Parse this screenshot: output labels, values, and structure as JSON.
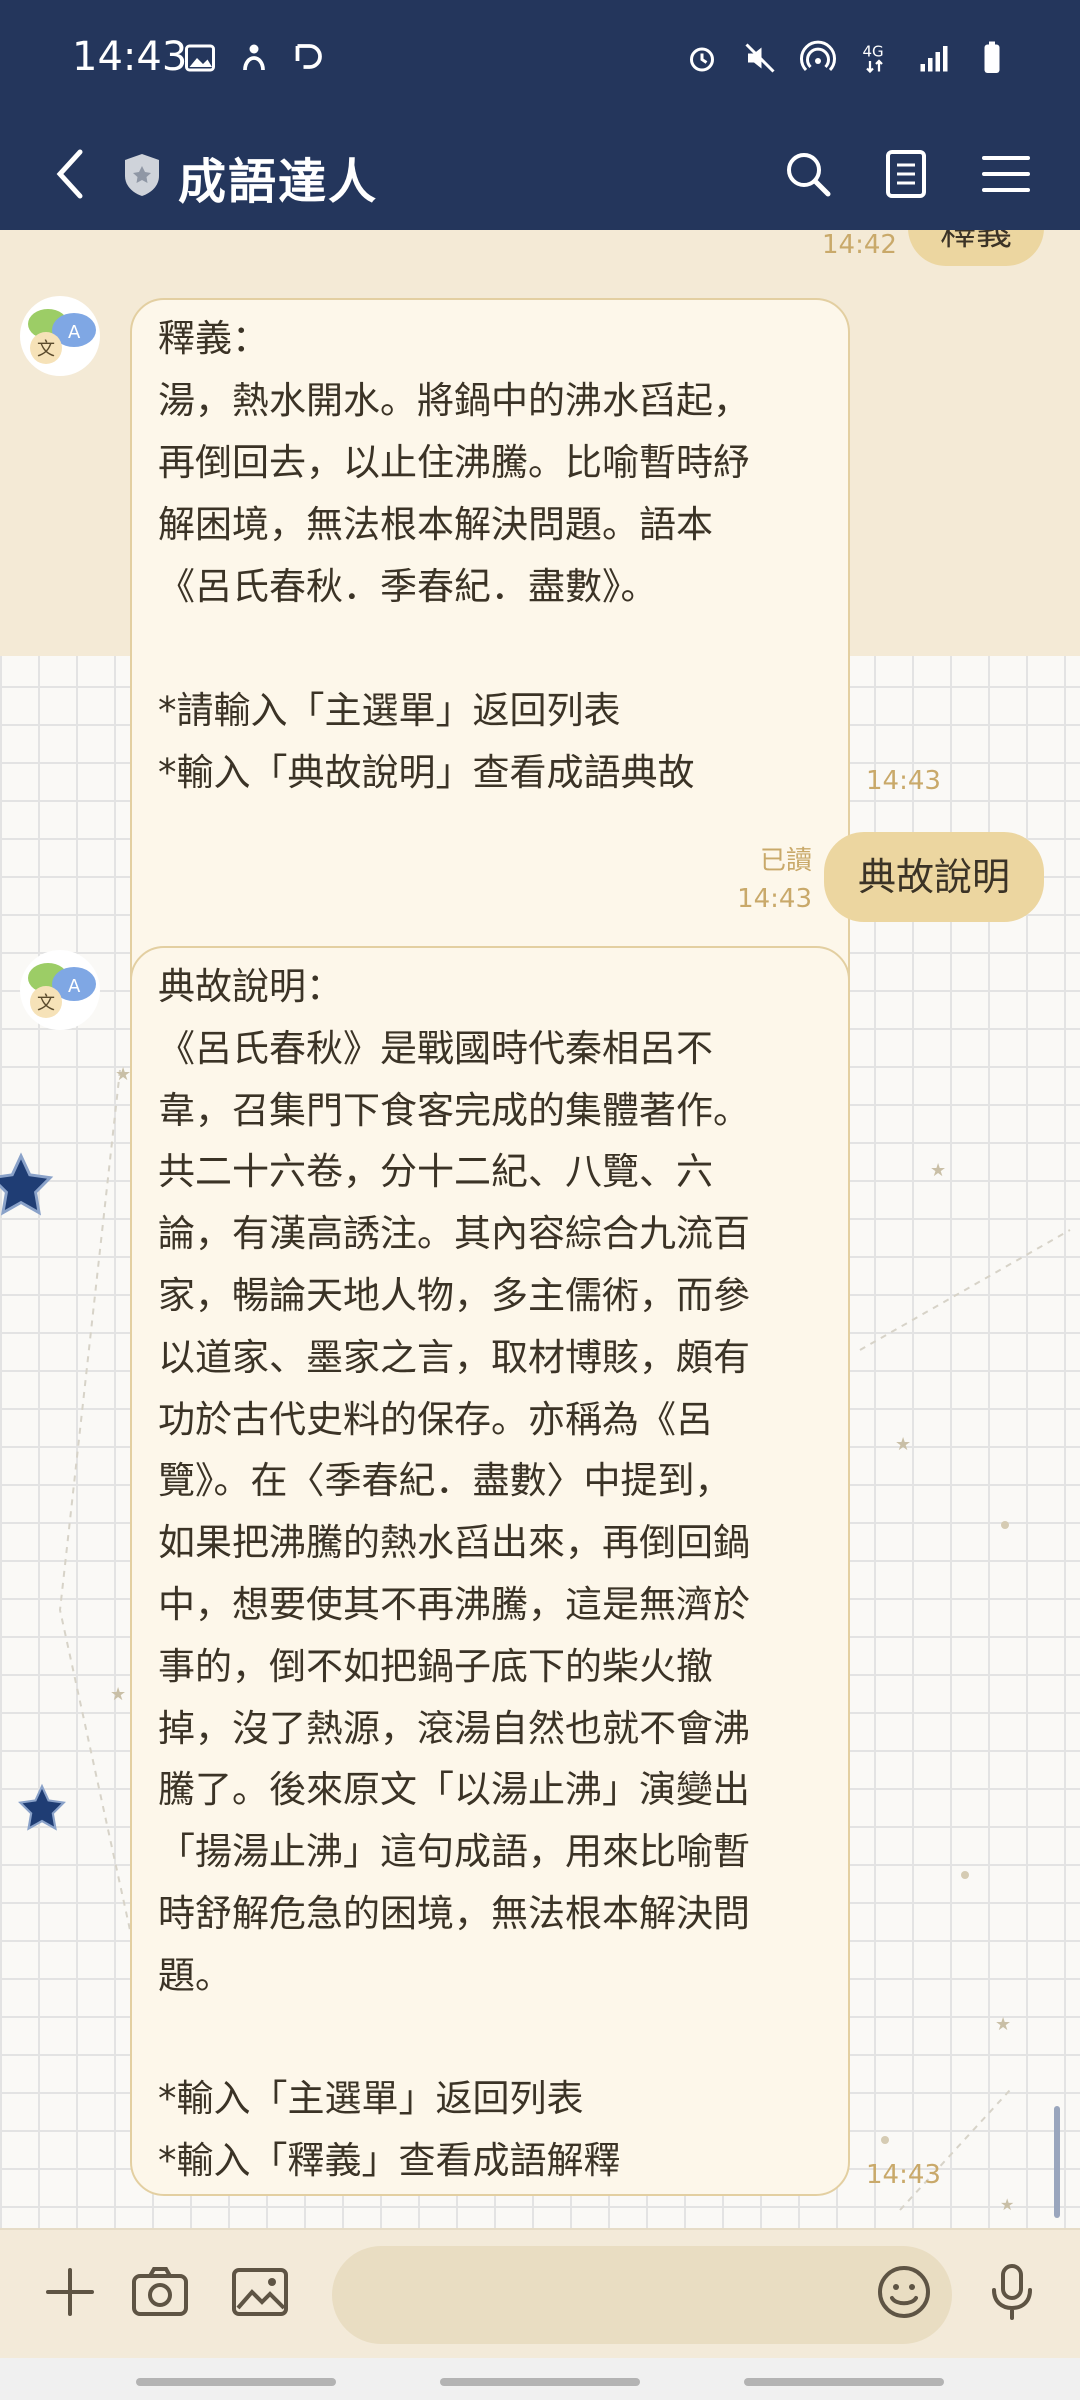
{
  "status_bar": {
    "time": "14:43",
    "left_icons": [
      "image-icon",
      "activity-icon",
      "sync-icon"
    ],
    "right_icons": [
      "alarm-icon",
      "mute-icon",
      "hotspot-icon",
      "4g-icon",
      "signal-icon",
      "battery-icon"
    ]
  },
  "header": {
    "title": "成語達人",
    "icons": [
      "back-icon",
      "shield-icon",
      "search-icon",
      "notes-icon",
      "menu-icon"
    ]
  },
  "chat": {
    "top_partial": {
      "time": "14:42",
      "label": "釋義"
    },
    "bot_message_1": {
      "text": "釋義：\n湯，熱水開水。將鍋中的沸水舀起，\n再倒回去，以止住沸騰。比喻暫時紓\n解困境，無法根本解決問題。語本\n《呂氏春秋．季春紀．盡數》。\n\n*請輸入「主選單」返回列表\n*輸入「典故說明」查看成語典故",
      "time": "14:43"
    },
    "user_message": {
      "read_label": "已讀",
      "time": "14:43",
      "text": "典故說明"
    },
    "bot_message_2": {
      "text": "典故說明：\n《呂氏春秋》是戰國時代秦相呂不\n韋，召集門下食客完成的集體著作。\n共二十六卷，分十二紀、八覽、六\n論，有漢高誘注。其內容綜合九流百\n家，暢論天地人物，多主儒術，而參\n以道家、墨家之言，取材博賅，頗有\n功於古代史料的保存。亦稱為《呂\n覽》。在〈季春紀．盡數〉中提到，\n如果把沸騰的熱水舀出來，再倒回鍋\n中，想要使其不再沸騰，這是無濟於\n事的，倒不如把鍋子底下的柴火撤\n掉，沒了熱源，滾湯自然也就不會沸\n騰了。後來原文「以湯止沸」演變出\n「揚湯止沸」這句成語，用來比喻暫\n時舒解危急的困境，無法根本解決問\n題。\n\n*輸入「主選單」返回列表\n*輸入「釋義」查看成語解釋",
      "time": "14:43"
    }
  },
  "input_bar": {
    "placeholder": "",
    "icons": [
      "plus-icon",
      "camera-icon",
      "image-icon",
      "emoji-icon",
      "mic-icon"
    ]
  },
  "colors": {
    "header_bg": "#24365c",
    "bubble_bg": "#fdf7ea",
    "bubble_border": "#e3cfa1",
    "user_bubble": "#ecd6a0",
    "timestamp": "#c9a96a"
  }
}
